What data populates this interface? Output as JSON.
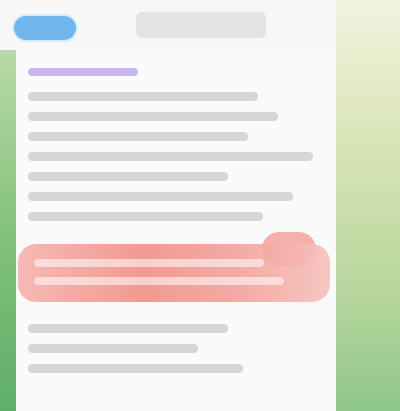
{
  "header": {
    "title": "",
    "left_button_label": "",
    "avatar_alt": ""
  },
  "content": {
    "link_text": "",
    "lines": [
      "",
      "",
      "",
      "",
      "",
      "",
      ""
    ],
    "highlight_lines": [
      "",
      ""
    ],
    "bottom_lines": [
      "",
      "",
      ""
    ]
  },
  "colors": {
    "header_bg": "#f7f7f7",
    "accent_blue": "#6fb7ee",
    "highlight_red": "#f08f86",
    "side_green": "#7fc07a"
  }
}
